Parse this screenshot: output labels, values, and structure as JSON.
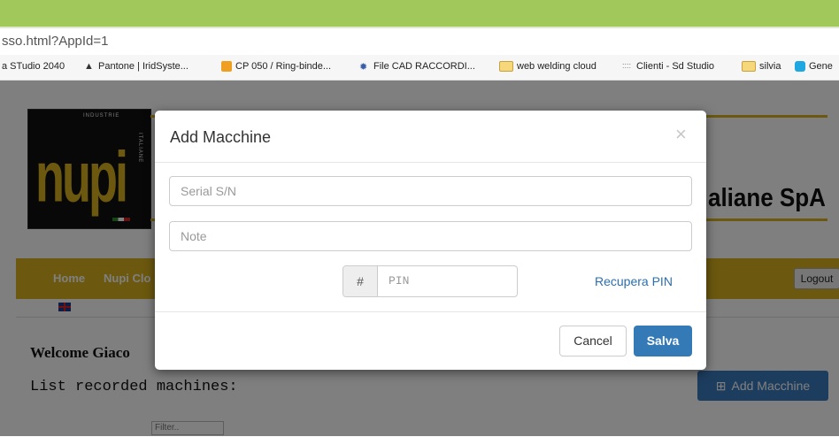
{
  "browser": {
    "url": "sso.html?AppId=1",
    "bookmarks": [
      "a STudio 2040",
      "Pantone | IridSyste...",
      "CP 050 / Ring-binde...",
      "File CAD RACCORDI...",
      "web welding cloud",
      "Clienti - Sd Studio",
      "silvia",
      "Gene"
    ]
  },
  "site": {
    "company_name": "aliane SpA",
    "nav": [
      "Home",
      "Nupi Clo"
    ],
    "logout_label": "Logout",
    "welcome": "Welcome Giaco",
    "list_heading": "List recorded machines:",
    "add_button_label": "Add Macchine",
    "filter_placeholder": "Filter.."
  },
  "modal": {
    "title": "Add Macchine",
    "close_glyph": "×",
    "serial_placeholder": "Serial S/N",
    "note_placeholder": "Note",
    "pin_addon": "#",
    "pin_placeholder": "PIN",
    "recover_pin_label": "Recupera PIN",
    "cancel_label": "Cancel",
    "save_label": "Salva"
  },
  "colors": {
    "browser_top": "#a0c85a",
    "brand_gold": "#d9b21f",
    "primary": "#337ab7"
  }
}
